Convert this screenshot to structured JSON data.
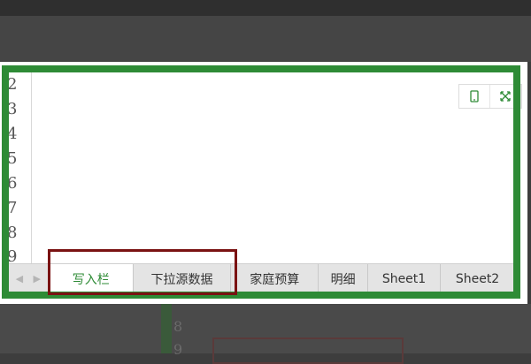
{
  "row_numbers": [
    "2",
    "3",
    "4",
    "5",
    "6",
    "7",
    "8",
    "9"
  ],
  "toolbar": {
    "icons": [
      "phone-icon",
      "expand-icon",
      "copy-icon"
    ]
  },
  "tabs": [
    {
      "label": "写入栏",
      "active": true
    },
    {
      "label": "下拉源数据",
      "active": false
    },
    {
      "label": "家庭预算",
      "active": false
    },
    {
      "label": "明细",
      "active": false
    },
    {
      "label": "Sheet1",
      "active": false
    },
    {
      "label": "Sheet2",
      "active": false
    }
  ],
  "nav": {
    "prev": "◀",
    "next": "▶"
  },
  "background": {
    "row_numbers": [
      "8",
      "9"
    ]
  },
  "colors": {
    "frame": "#2e8b36",
    "highlight": "#7a1212",
    "active_tab_text": "#2e8b36"
  }
}
